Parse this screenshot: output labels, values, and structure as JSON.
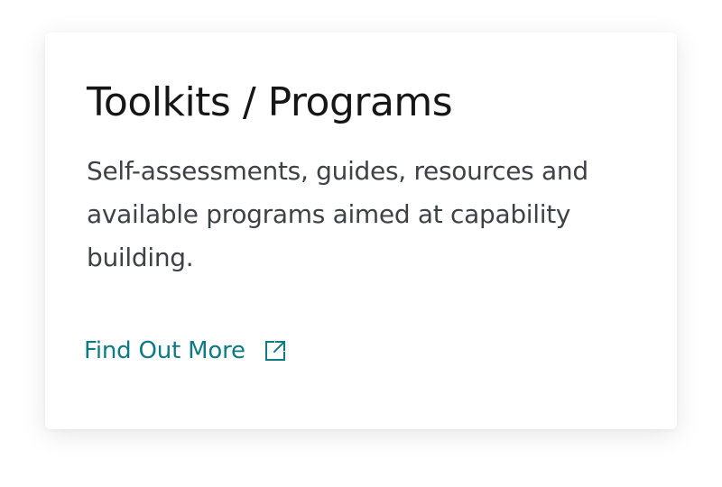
{
  "card": {
    "title": "Toolkits / Programs",
    "description": "Self-assessments, guides, resources and available programs aimed at capability building.",
    "link": {
      "label": "Find Out More",
      "icon": "external-link-icon"
    }
  },
  "colors": {
    "title": "#161616",
    "description": "#3e4247",
    "link": "#0e7a83",
    "card_background": "#ffffff"
  }
}
